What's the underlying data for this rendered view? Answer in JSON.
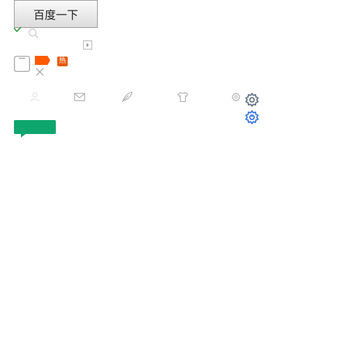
{
  "search": {
    "button_label": "百度一下"
  },
  "badges": {
    "hot_label": "热",
    "tip_label": ""
  },
  "icons": {
    "check": "check-icon",
    "magnifier": "search-icon",
    "play_box": "play-box-icon",
    "tablet": "tablet-icon",
    "new_tag": "tag-icon",
    "close": "close-icon",
    "user": "user-icon",
    "mail": "mail-icon",
    "feather": "feather-icon",
    "shirt": "shirt-icon",
    "small_gear": "gear-icon",
    "gear": "gear-icon",
    "gear_active": "gear-icon"
  },
  "colors": {
    "check": "#2e9e3a",
    "icon_gray": "#a9a9a9",
    "tag_orange": "#ff5a00",
    "hot_badge": "#e8590c",
    "gear_gray": "#6b7685",
    "gear_blue": "#3a7be0",
    "tip_green": "#0fa66e"
  }
}
